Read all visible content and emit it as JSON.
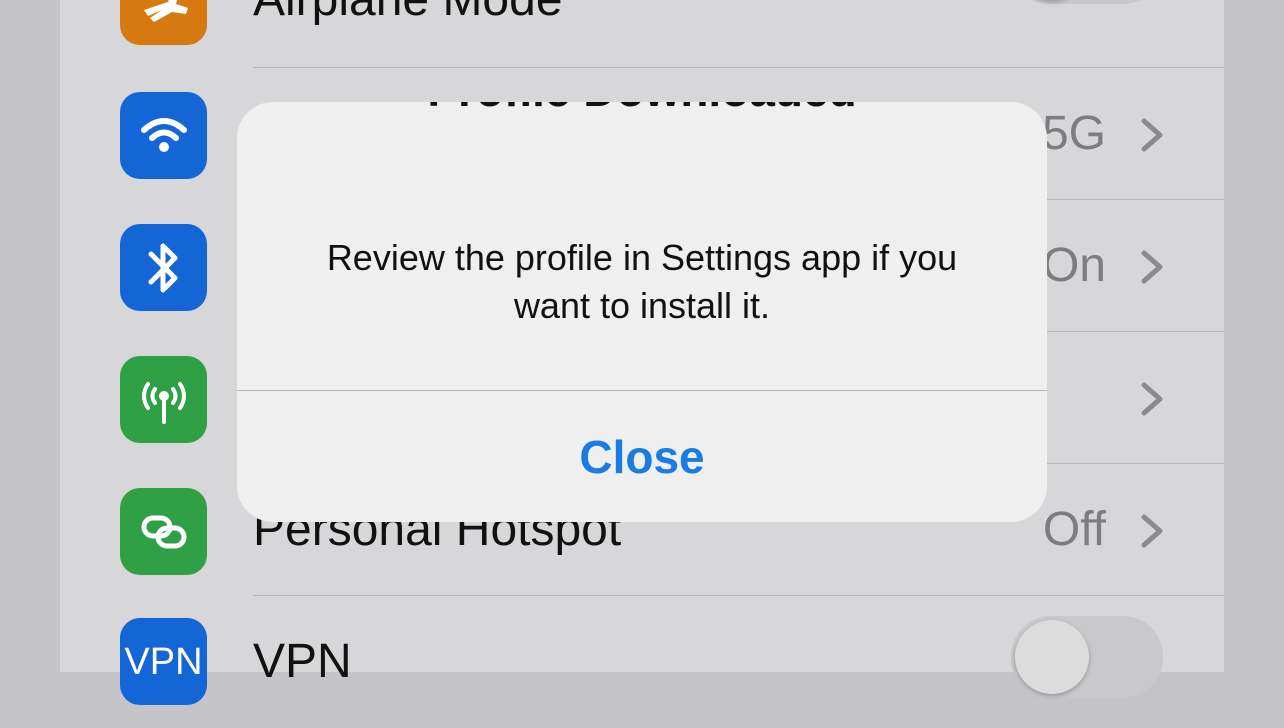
{
  "settings": {
    "rows": [
      {
        "label": "Airplane Mode",
        "icon": "airplane-icon",
        "color": "#d67a10",
        "control": "toggle"
      },
      {
        "label": "",
        "icon": "wifi-icon",
        "color": "#1466d6",
        "value": "5G",
        "control": "chevron"
      },
      {
        "label": "",
        "icon": "bluetooth-icon",
        "color": "#1466d6",
        "value": "On",
        "control": "chevron"
      },
      {
        "label": "",
        "icon": "cellular-icon",
        "color": "#2fa046",
        "value": "",
        "control": "chevron"
      },
      {
        "label": "Personal Hotspot",
        "icon": "hotspot-icon",
        "color": "#2fa046",
        "value": "Off",
        "control": "chevron"
      },
      {
        "label": "VPN",
        "icon": "vpn-icon",
        "icon_text": "VPN",
        "color": "#1466d6",
        "control": "toggle"
      }
    ]
  },
  "alert": {
    "title": "Profile Downloaded",
    "message": "Review the profile in Settings app if you want to install it.",
    "button_label": "Close",
    "button_color": "#1a7be3"
  }
}
